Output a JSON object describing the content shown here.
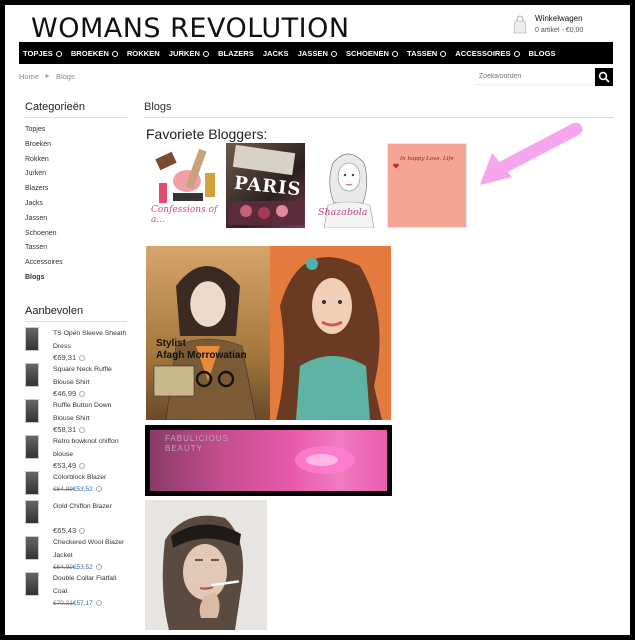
{
  "site": {
    "title": "WOMANS REVOLUTION"
  },
  "cart": {
    "title": "Winkelwagen",
    "summary": "0 artikel - €0,00"
  },
  "nav": [
    {
      "label": "TOPJES",
      "dropdown": true
    },
    {
      "label": "BROEKEN",
      "dropdown": true
    },
    {
      "label": "ROKKEN",
      "dropdown": false
    },
    {
      "label": "JURKEN",
      "dropdown": true
    },
    {
      "label": "BLAZERS",
      "dropdown": false
    },
    {
      "label": "JACKS",
      "dropdown": false
    },
    {
      "label": "JASSEN",
      "dropdown": true
    },
    {
      "label": "SCHOENEN",
      "dropdown": true
    },
    {
      "label": "TASSEN",
      "dropdown": true
    },
    {
      "label": "ACCESSOIRES",
      "dropdown": true
    },
    {
      "label": "BLOGS",
      "dropdown": false
    }
  ],
  "breadcrumb": {
    "home": "Home",
    "current": "Blogs"
  },
  "search": {
    "placeholder": "Zoekwoorden"
  },
  "sidebar": {
    "categories_heading": "Categorieën",
    "categories": [
      "Topjes",
      "Broeken",
      "Rokken",
      "Jurken",
      "Blazers",
      "Jacks",
      "Jassen",
      "Schoenen",
      "Tassen",
      "Accessoires",
      "Blogs"
    ],
    "active_category": "Blogs",
    "recommended_heading": "Aanbevolen",
    "products": [
      {
        "name": "TS Open Sleeve Sheath Dress",
        "price": "€69,31",
        "old_price": "",
        "new_price": ""
      },
      {
        "name": "Square Neck Ruffle Blouse Shirt",
        "price": "€46,99",
        "old_price": "",
        "new_price": ""
      },
      {
        "name": "Ruffle Button Down Blouse Shirt",
        "price": "€58,31",
        "old_price": "",
        "new_price": ""
      },
      {
        "name": "Retro bowknot chiffon blouse",
        "price": "€53,49",
        "old_price": "",
        "new_price": ""
      },
      {
        "name": "Colorblock Blazer",
        "price": "",
        "old_price": "€64,99",
        "new_price": "€53,52"
      },
      {
        "name": "Gold Chiffon Blazer",
        "price": "€65,43",
        "old_price": "",
        "new_price": ""
      },
      {
        "name": "Checkered Wool Blazer Jacket",
        "price": "",
        "old_price": "€64,99",
        "new_price": "€53,52"
      },
      {
        "name": "Double Collar Flatfall Coat",
        "price": "",
        "old_price": "€70,21",
        "new_price": "€57,17"
      }
    ]
  },
  "main": {
    "page_title": "Blogs",
    "favorites_heading": "Favoriete Bloggers:",
    "tiles": [
      {
        "caption": "Confessions of a..."
      },
      {
        "caption": "PARIS"
      },
      {
        "caption": "Shazabola"
      },
      {
        "caption": "In happy Love. Life"
      }
    ],
    "stylist_label": "Stylist\nAfagh Morrowatian",
    "beauty_banner_text": "FABULICIOUS\nBEAUTY"
  },
  "colors": {
    "nav_bg": "#000000",
    "arrow": "#f5a6ec",
    "price_new": "#3366aa"
  }
}
